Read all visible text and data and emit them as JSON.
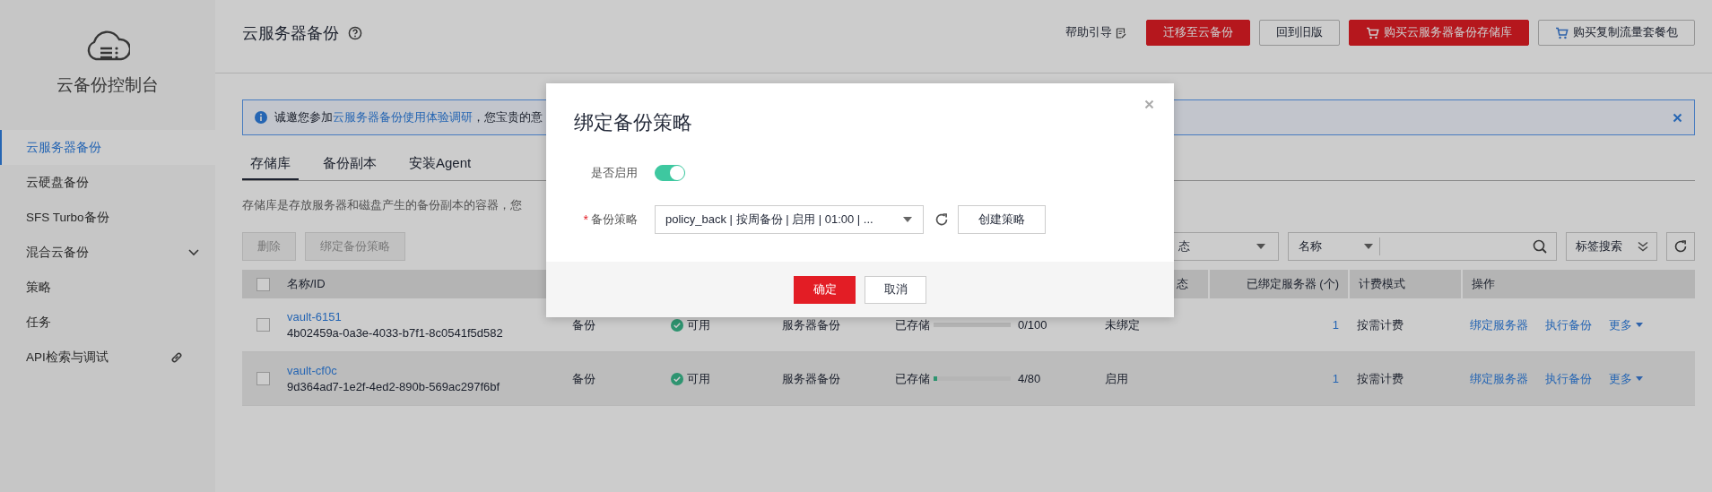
{
  "sidebar": {
    "title": "云备份控制台",
    "items": [
      {
        "label": "云服务器备份",
        "selected": true,
        "kind": "plain"
      },
      {
        "label": "云硬盘备份",
        "selected": false,
        "kind": "plain"
      },
      {
        "label": "SFS Turbo备份",
        "selected": false,
        "kind": "plain"
      },
      {
        "label": "混合云备份",
        "selected": false,
        "kind": "submenu"
      },
      {
        "label": "策略",
        "selected": false,
        "kind": "plain"
      },
      {
        "label": "任务",
        "selected": false,
        "kind": "plain"
      },
      {
        "label": "API检索与调试",
        "selected": false,
        "kind": "external"
      }
    ]
  },
  "header": {
    "title": "云服务器备份",
    "help": "帮助引导",
    "buttons": [
      {
        "label": "迁移至云备份",
        "kind": "primary",
        "cart": false
      },
      {
        "label": "回到旧版",
        "kind": "default",
        "cart": false
      },
      {
        "label": "购买云服务器备份存储库",
        "kind": "primary",
        "cart": true
      },
      {
        "label": "购买复制流量套餐包",
        "kind": "default",
        "cart": true
      }
    ]
  },
  "notice": {
    "prefix": "诚邀您参加",
    "link": "云服务器备份使用体验调研",
    "suffix": "，您宝贵的意"
  },
  "tabs": [
    {
      "label": "存储库",
      "selected": true
    },
    {
      "label": "备份副本",
      "selected": false
    },
    {
      "label": "安装Agent",
      "selected": false
    }
  ],
  "description": "存储库是存放服务器和磁盘产生的备份副本的容器，您",
  "toolbar": {
    "buttons": [
      {
        "label": "删除",
        "disabled": true
      },
      {
        "label": "绑定备份策略",
        "disabled": true
      }
    ],
    "status_filter": "态",
    "field_filter": "名称",
    "tag_search": "标签搜索"
  },
  "table": {
    "select_all_checked": false,
    "headers": {
      "name": "名称/ID",
      "state": "态",
      "bound": "已绑定服务器 (个)",
      "billing": "计费模式",
      "actions": "操作"
    },
    "rows": [
      {
        "checked": false,
        "hovered": false,
        "name": "vault-6151",
        "id": "4b02459a-0a3e-4033-b7f1-8c0541f5d582",
        "type": "备份",
        "status": "可用",
        "storage": "服务器备份",
        "capacity_label": "已存储",
        "level": 0,
        "capacity": "0/100",
        "state": "未绑定",
        "bound": "1",
        "billing": "按需计费",
        "actions": [
          "绑定服务器",
          "执行备份",
          "更多"
        ]
      },
      {
        "checked": false,
        "hovered": true,
        "name": "vault-cf0c",
        "id": "9d364ad7-1e2f-4ed2-890b-569ac297f6bf",
        "type": "备份",
        "status": "可用",
        "storage": "服务器备份",
        "capacity_label": "已存储",
        "level": 0.05,
        "capacity": "4/80",
        "state": "启用",
        "bound": "1",
        "billing": "按需计费",
        "actions": [
          "绑定服务器",
          "执行备份",
          "更多"
        ]
      }
    ]
  },
  "dialog": {
    "title": "绑定备份策略",
    "enable_label": "是否启用",
    "enabled": true,
    "policy_label": "备份策略",
    "required_mark": "*",
    "policy_value": "policy_back | 按周备份 | 启用 | 01:00 | ...",
    "create_button": "创建策略",
    "ok": "确定",
    "cancel": "取消"
  }
}
